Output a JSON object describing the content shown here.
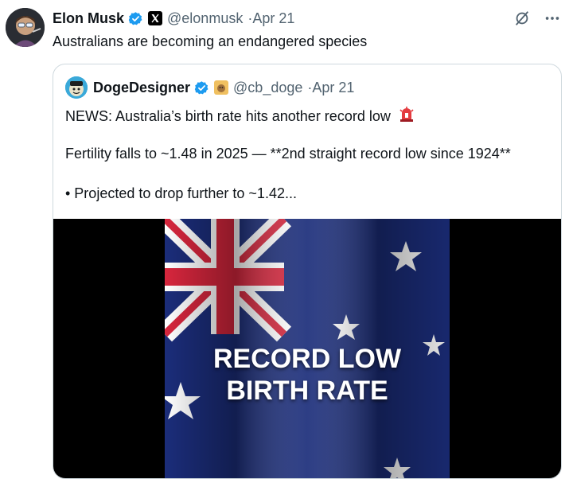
{
  "tweet": {
    "author_name": "Elon Musk",
    "handle": "@elonmusk",
    "separator": "·",
    "date": "Apr 21",
    "text": "Australians are becoming an endangered species",
    "avatar_icon": "avatar-illustration",
    "actions": [
      "grok-icon",
      "more-icon"
    ]
  },
  "quoted": {
    "author_name": "DogeDesigner",
    "handle": "@cb_doge",
    "separator": "·",
    "date": "Apr 21",
    "line1": "NEWS: Australia’s birth rate hits another record low",
    "line1_emoji": "🚨",
    "line2": "Fertility falls to ~1.48 in 2025 — **2nd straight record low since 1924**",
    "line3": "• Projected to drop further to ~1.42...",
    "media_caption_line1": "RECORD LOW",
    "media_caption_line2": "BIRTH RATE"
  },
  "colors": {
    "verified_blue": "#1d9bf0",
    "muted_text": "#536471",
    "border": "#cfd9de",
    "flag_blue": "#1b2d7a",
    "flag_red": "#d7263d"
  }
}
